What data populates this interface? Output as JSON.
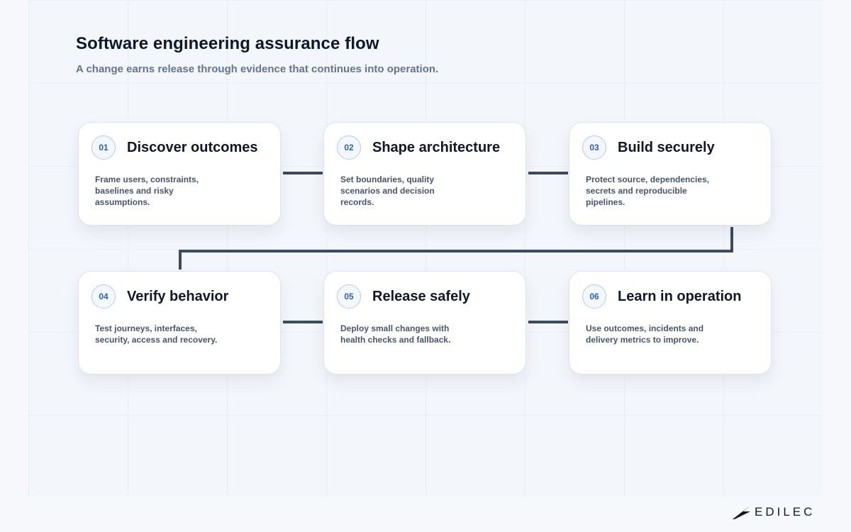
{
  "header": {
    "title": "Software engineering assurance flow",
    "subtitle": "A change earns release through evidence that continues into operation."
  },
  "steps": [
    {
      "number": "01",
      "title": "Discover outcomes",
      "description": "Frame users, constraints, baselines and risky assumptions."
    },
    {
      "number": "02",
      "title": "Shape architecture",
      "description": "Set boundaries, quality scenarios and decision records."
    },
    {
      "number": "03",
      "title": "Build securely",
      "description": "Protect source, dependencies, secrets and reproducible pipelines."
    },
    {
      "number": "04",
      "title": "Verify behavior",
      "description": "Test journeys, interfaces, security, access and recovery."
    },
    {
      "number": "05",
      "title": "Release safely",
      "description": "Deploy small changes with health checks and fallback."
    },
    {
      "number": "06",
      "title": "Learn in operation",
      "description": "Use outcomes, incidents and delivery metrics to improve."
    }
  ],
  "brand": {
    "name": "EDILEC",
    "icon": "edilec-logo-icon"
  },
  "colors": {
    "connector": "#3f4a5c",
    "badge_text": "#2f5fb3",
    "badge_border": "#b6c8ea"
  }
}
